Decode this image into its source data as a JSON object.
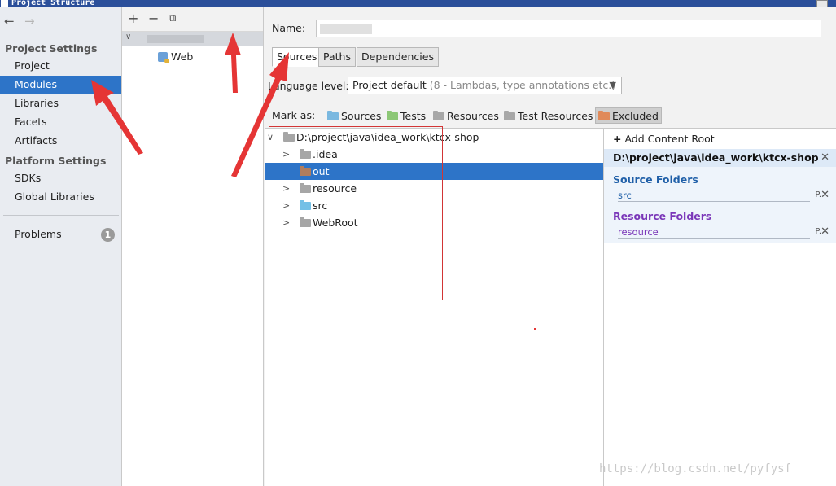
{
  "window": {
    "title": "Project Structure"
  },
  "left_nav": {
    "back": "←",
    "forward": "→",
    "project_settings_header": "Project Settings",
    "project_settings": [
      "Project",
      "Modules",
      "Libraries",
      "Facets",
      "Artifacts"
    ],
    "selected_item": "Modules",
    "platform_settings_header": "Platform Settings",
    "platform_settings": [
      "SDKs",
      "Global Libraries"
    ],
    "problems_label": "Problems",
    "problems_count": "1"
  },
  "module_tree": {
    "toolbar": {
      "add": "+",
      "remove": "−",
      "copy": "⧉"
    },
    "facet": "Web"
  },
  "main": {
    "name_label": "Name:",
    "tabs": [
      "Sources",
      "Paths",
      "Dependencies"
    ],
    "active_tab": "Sources",
    "language_level_label": "Language level:",
    "language_level_value": "Project default",
    "language_level_hint": "(8 - Lambdas, type annotations etc.)",
    "mark_as_label": "Mark as:",
    "mark_as": [
      {
        "label": "Sources",
        "color": "#7ab8e0"
      },
      {
        "label": "Tests",
        "color": "#8cc776"
      },
      {
        "label": "Resources",
        "color": "#a8a8a8"
      },
      {
        "label": "Test Resources",
        "color": "#a8a8a8"
      },
      {
        "label": "Excluded",
        "color": "#e08a5a"
      }
    ]
  },
  "content_tree": {
    "root": "D:\\project\\java\\idea_work\\ktcx-shop",
    "items": [
      {
        "label": ".idea",
        "color": "#a6a6a6"
      },
      {
        "label": "out",
        "color": "#b07d5e"
      },
      {
        "label": "resource",
        "color": "#a6a6a6"
      },
      {
        "label": "src",
        "color": "#74c0e6"
      },
      {
        "label": "WebRoot",
        "color": "#a6a6a6"
      }
    ],
    "selected": "out"
  },
  "roots_panel": {
    "add_content_root": "Add Content Root",
    "root_path": "D:\\project\\java\\idea_work\\ktcx-shop",
    "source_folders_header": "Source Folders",
    "source_folders": [
      "src"
    ],
    "resource_folders_header": "Resource Folders",
    "resource_folders": [
      "resource"
    ],
    "source_color": "#1f5fa8",
    "resource_color": "#7a36b8"
  },
  "watermark": "https://blog.csdn.net/pyfysf",
  "colors": {
    "selection": "#2d74c8",
    "annotation": "#e53535"
  }
}
